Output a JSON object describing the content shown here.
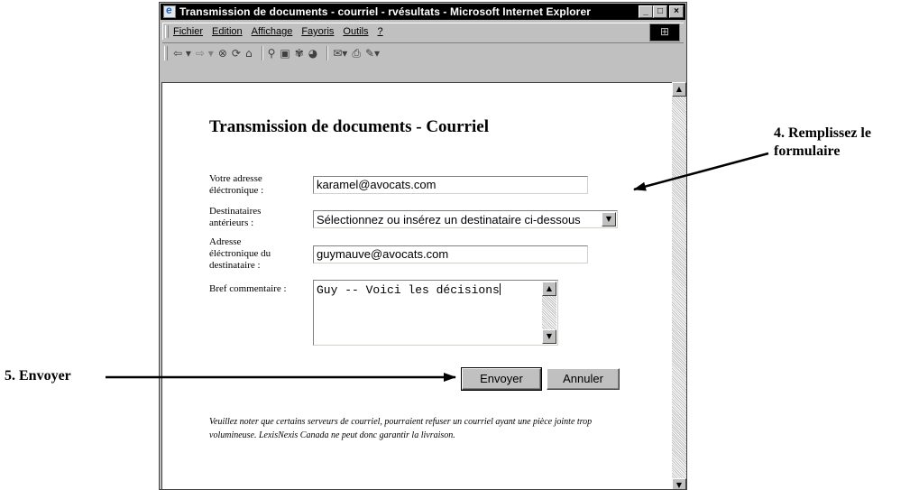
{
  "window": {
    "title": "Transmission de documents - courriel - rvésultats - Microsoft Internet Explorer",
    "controls": [
      "_",
      "□",
      "×"
    ]
  },
  "menubar": {
    "items": [
      "Fichier",
      "Edition",
      "Affichage",
      "Fayoris",
      "Outils",
      "?"
    ]
  },
  "toolbar": {
    "icons": [
      "back-arrow-icon",
      "forward-arrow-icon",
      "stop-icon",
      "refresh-icon",
      "home-icon",
      "search-icon",
      "favorites-icon",
      "history-icon",
      "channels-icon",
      "mail-icon",
      "print-icon",
      "edit-icon"
    ]
  },
  "form": {
    "title": "Transmission de documents - Courriel",
    "email_label": "Votre adresse éléctronique :",
    "email_value": "karamel@avocats.com",
    "recipients_label": "Destinataires antérieurs :",
    "recipients_value": "Sélectionnez ou insérez un destinataire ci-dessous",
    "recipient_email_label": "Adresse éléctronique du destinataire :",
    "recipient_email_value": "guymauve@avocats.com",
    "comment_label": "Bref commentaire :",
    "comment_value": "Guy -- Voici les décisions",
    "send_label": "Envoyer",
    "cancel_label": "Annuler",
    "note": "Veuillez noter que certains serveurs de courriel, pourraient refuser un courriel ayant une pièce jointe trop volumineuse. LexisNexis Canada ne peut donc garantir la livraison."
  },
  "callouts": {
    "step4": "4. Remplissez le formulaire",
    "step5": "5. Envoyer"
  }
}
